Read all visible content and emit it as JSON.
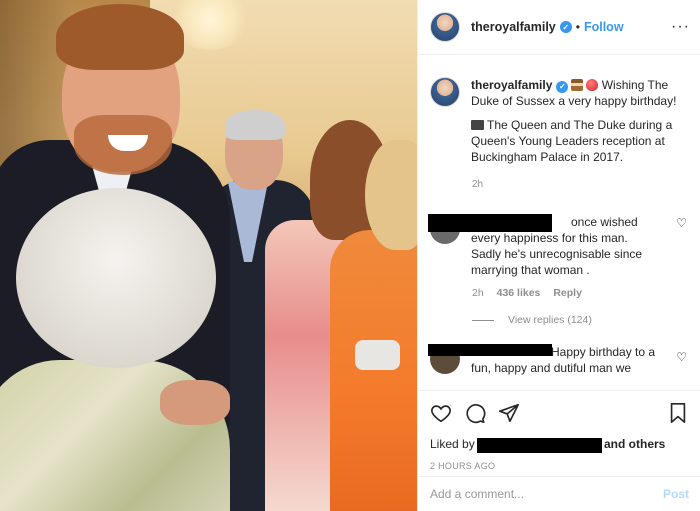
{
  "post": {
    "username": "theroyalfamily",
    "follow_label": "Follow",
    "dot": "•",
    "more_icon": "more-horizontal-icon",
    "caption_line1": "Wishing The Duke of Sussex a very happy birthday!",
    "caption_line2": "The Queen and The Duke during a Queen's Young Leaders reception at Buckingham Palace in 2017.",
    "caption_time": "2h"
  },
  "comments": [
    {
      "text": "once wished every happiness for this man. Sadly he's unrecognisable since marrying that woman .",
      "time": "2h",
      "likes": "436 likes",
      "reply_label": "Reply",
      "view_replies": "View replies (124)"
    },
    {
      "text": "Happy birthday to a fun, happy and dutiful man we"
    }
  ],
  "actions": {
    "liked_by_prefix": "Liked by",
    "liked_by_suffix": "and others",
    "posted_ago": "2 HOURS AGO",
    "add_comment_placeholder": "Add a comment...",
    "post_label": "Post"
  },
  "colors": {
    "accent": "#3897f0",
    "muted": "#8e8e8e",
    "post_disabled": "#b3dbff"
  }
}
